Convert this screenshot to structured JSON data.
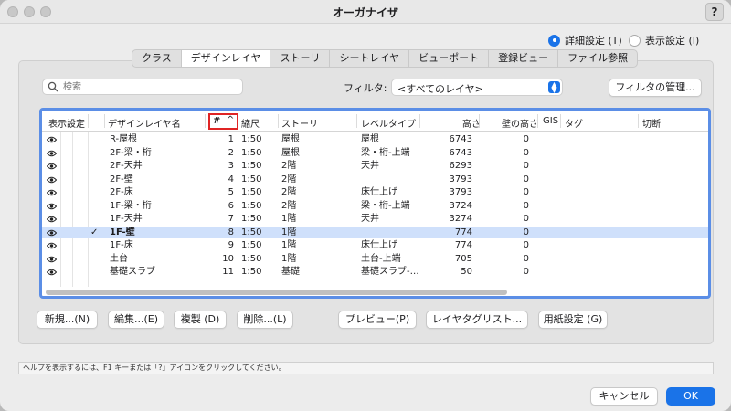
{
  "window": {
    "title": "オーガナイザ",
    "help": "?"
  },
  "modes": {
    "detail": "詳細設定 (T)",
    "simple": "表示設定 (I)"
  },
  "tabs": [
    "クラス",
    "デザインレイヤ",
    "ストーリ",
    "シートレイヤ",
    "ビューポート",
    "登録ビュー",
    "ファイル参照"
  ],
  "active_tab": "デザインレイヤ",
  "search": {
    "placeholder": "検索"
  },
  "filter": {
    "label": "フィルタ:",
    "value": "<すべてのレイヤ>",
    "manage_button": "フィルタの管理..."
  },
  "columns": {
    "visibility": "表示設定",
    "name": "デザインレイヤ名",
    "num": "#",
    "sort_indicator": "^",
    "scale": "縮尺",
    "story": "ストーリ",
    "level": "レベルタイプ",
    "height": "高さ",
    "wall_height": "壁の高さ",
    "gis": "GIS",
    "tag": "タグ",
    "cut": "切断"
  },
  "rows": [
    {
      "name": "R-屋根",
      "num": "1",
      "scale": "1:50",
      "story": "屋根",
      "level": "屋根",
      "height": "6743",
      "wall": "0",
      "active": false
    },
    {
      "name": "2F-梁・桁",
      "num": "2",
      "scale": "1:50",
      "story": "屋根",
      "level": "梁・桁-上端",
      "height": "6743",
      "wall": "0",
      "active": false
    },
    {
      "name": "2F-天井",
      "num": "3",
      "scale": "1:50",
      "story": "2階",
      "level": "天井",
      "height": "6293",
      "wall": "0",
      "active": false
    },
    {
      "name": "2F-壁",
      "num": "4",
      "scale": "1:50",
      "story": "2階",
      "level": "",
      "height": "3793",
      "wall": "0",
      "active": false
    },
    {
      "name": "2F-床",
      "num": "5",
      "scale": "1:50",
      "story": "2階",
      "level": "床仕上げ",
      "height": "3793",
      "wall": "0",
      "active": false
    },
    {
      "name": "1F-梁・桁",
      "num": "6",
      "scale": "1:50",
      "story": "2階",
      "level": "梁・桁-上端",
      "height": "3724",
      "wall": "0",
      "active": false
    },
    {
      "name": "1F-天井",
      "num": "7",
      "scale": "1:50",
      "story": "1階",
      "level": "天井",
      "height": "3274",
      "wall": "0",
      "active": false
    },
    {
      "name": "1F-壁",
      "num": "8",
      "scale": "1:50",
      "story": "1階",
      "level": "",
      "height": "774",
      "wall": "0",
      "active": true,
      "check": "✓"
    },
    {
      "name": "1F-床",
      "num": "9",
      "scale": "1:50",
      "story": "1階",
      "level": "床仕上げ",
      "height": "774",
      "wall": "0",
      "active": false
    },
    {
      "name": "土台",
      "num": "10",
      "scale": "1:50",
      "story": "1階",
      "level": "土台-上端",
      "height": "705",
      "wall": "0",
      "active": false
    },
    {
      "name": "基礎スラブ",
      "num": "11",
      "scale": "1:50",
      "story": "基礎",
      "level": "基礎スラブ-…",
      "height": "50",
      "wall": "0",
      "active": false
    }
  ],
  "buttons": {
    "new": "新規...(N)",
    "edit": "編集...(E)",
    "duplicate": "複製 (D)",
    "delete": "削除...(L)",
    "preview": "プレビュー(P)",
    "tag_list": "レイヤタグリスト...",
    "paper": "用紙設定 (G)",
    "cancel": "キャンセル",
    "ok": "OK"
  },
  "status_text": "ヘルプを表示するには、F1 キーまたは「?」アイコンをクリックしてください。",
  "colors": {
    "accent": "#1a73e8",
    "selection": "#cfe0fb",
    "table_border": "#5b8ee6",
    "sort_highlight": "#e02424"
  }
}
